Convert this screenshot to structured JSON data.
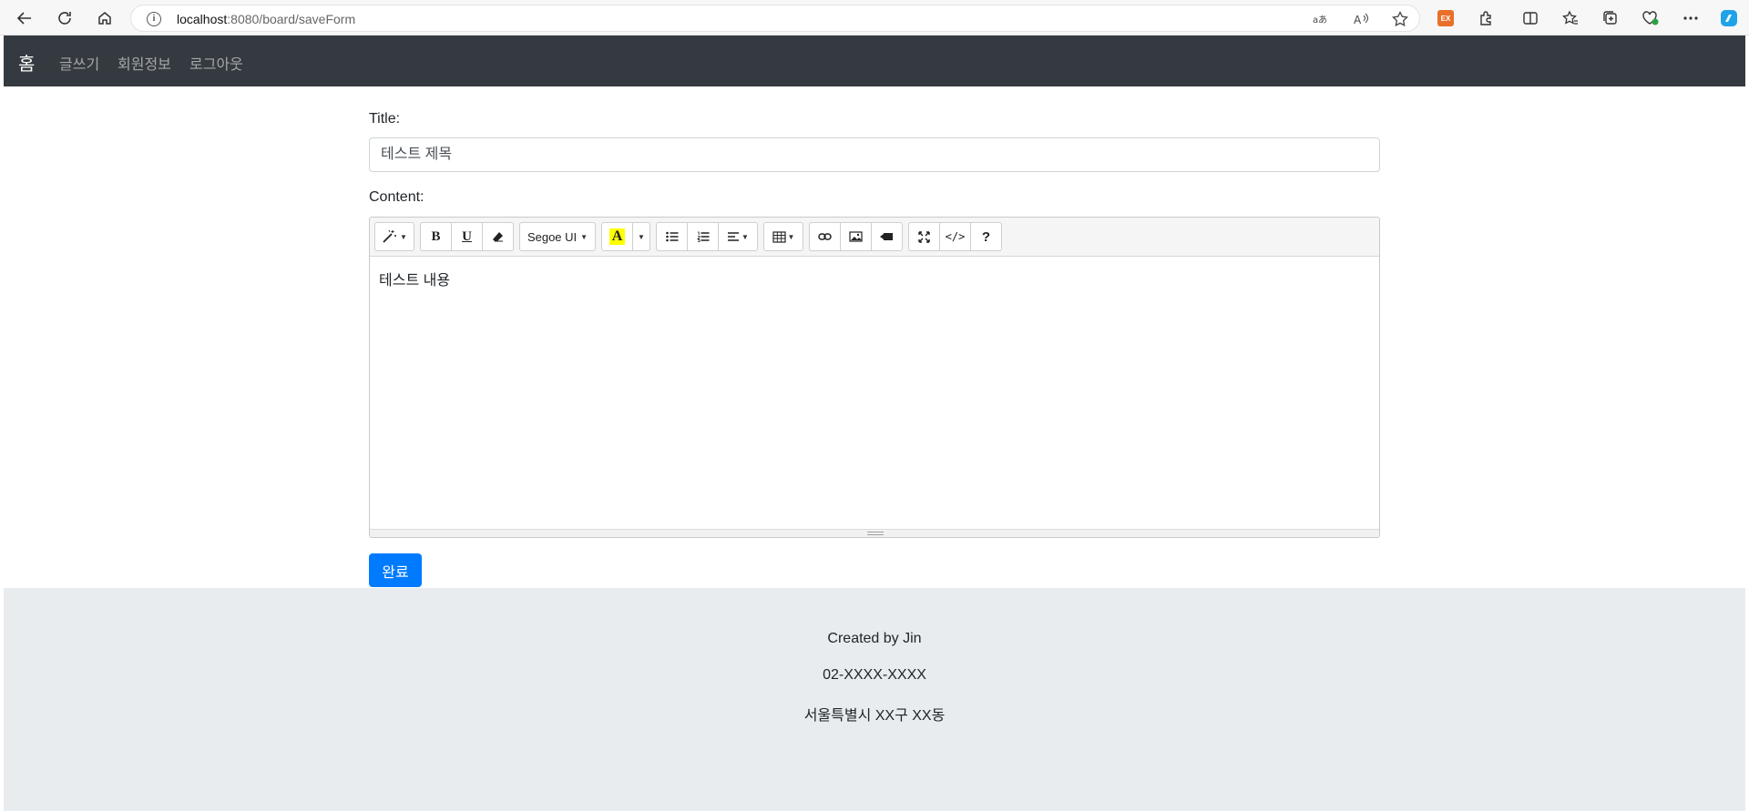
{
  "browser": {
    "url_host": "localhost",
    "url_path": ":8080/board/saveForm",
    "extension_badge": "EX"
  },
  "navbar": {
    "brand": "홈",
    "links": [
      "글쓰기",
      "회원정보",
      "로그아웃"
    ]
  },
  "form": {
    "title_label": "Title:",
    "title_value": "테스트 제목",
    "content_label": "Content:",
    "content_value": "테스트 내용",
    "submit_label": "완료"
  },
  "editor": {
    "font_name": "Segoe UI",
    "bold_glyph": "B",
    "underline_glyph": "U",
    "color_glyph": "A",
    "code_glyph": "</>",
    "help_glyph": "?",
    "highlight_color": "#ffff00"
  },
  "footer": {
    "lines": [
      "Created by Jin",
      "02-XXXX-XXXX",
      "서울특별시 XX구 XX동"
    ]
  },
  "colors": {
    "navbar_bg": "#343a40",
    "primary": "#007bff",
    "footer_bg": "#e9ecef"
  }
}
